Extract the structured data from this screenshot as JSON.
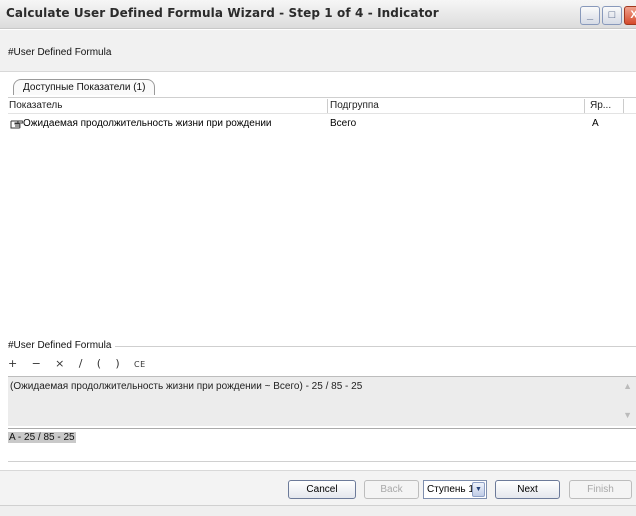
{
  "window": {
    "title": "Calculate User Defined Formula Wizard - Step 1 of 4 - Indicator",
    "min_symbol": "_",
    "max_symbol": "□",
    "close_symbol": "X"
  },
  "header": {
    "text": "#User Defined Formula"
  },
  "tab": {
    "label": "Доступные Показатели (1)"
  },
  "grid": {
    "columns": [
      "Показатель",
      "Подгруппа",
      "Яр..."
    ],
    "rows": [
      {
        "indicator": "Ожидаемая продолжительность жизни при рождении",
        "subgroup": "Всего",
        "short": "A",
        "icon": "hand-pointer-icon"
      }
    ]
  },
  "formula": {
    "legend": "#User Defined Formula",
    "operators": [
      "+",
      "−",
      "×",
      "/",
      "(",
      ")",
      "CE"
    ],
    "expression": "(Ожидаемая продолжительность жизни при рождении ~ Всего) - 25 / 85 - 25",
    "short_expression": "A - 25 / 85 - 25"
  },
  "footer": {
    "cancel_label": "Cancel",
    "back_label": "Back",
    "step_value": "Ступень 1",
    "next_label": "Next",
    "finish_label": "Finish"
  }
}
